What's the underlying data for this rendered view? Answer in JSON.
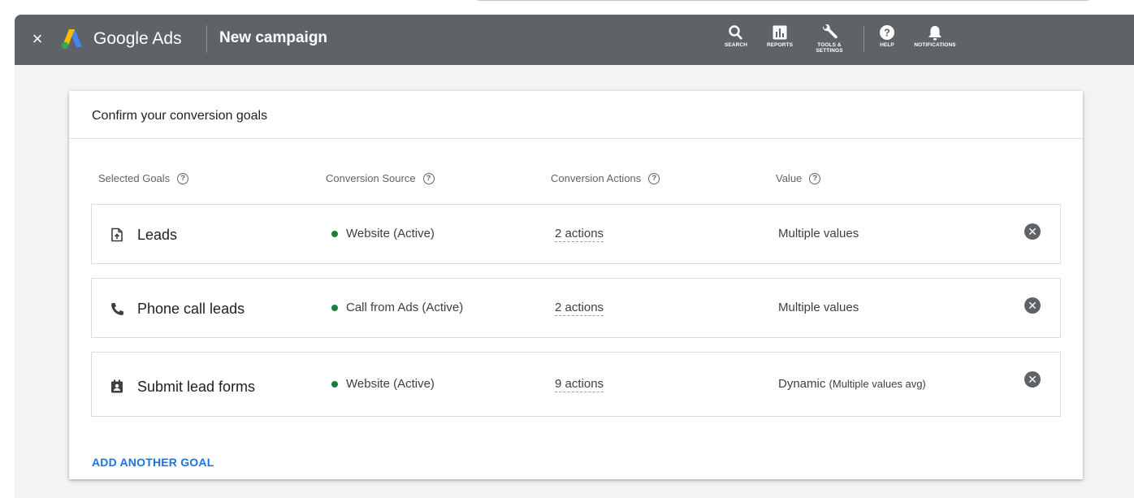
{
  "header": {
    "close_glyph": "×",
    "brand": "Google Ads",
    "page_title": "New campaign",
    "tools": [
      {
        "label": "SEARCH",
        "icon": "search-icon"
      },
      {
        "label": "REPORTS",
        "icon": "reports-icon"
      },
      {
        "label": "TOOLS &",
        "label2": "SETTINGS",
        "icon": "wrench-icon"
      },
      {
        "label": "HELP",
        "icon": "help-icon"
      },
      {
        "label": "NOTIFICATIONS",
        "icon": "bell-icon"
      }
    ]
  },
  "card": {
    "title": "Confirm your conversion goals",
    "columns": [
      "Selected Goals",
      "Conversion Source",
      "Conversion Actions",
      "Value"
    ],
    "help_glyph": "?",
    "remove_glyph": "✕",
    "goals": [
      {
        "name": "Leads",
        "icon": "upload-file-icon",
        "source": "Website (Active)",
        "actions": "2 actions",
        "value": "Multiple values",
        "value_sub": ""
      },
      {
        "name": "Phone call leads",
        "icon": "phone-icon",
        "source": "Call from Ads (Active)",
        "actions": "2 actions",
        "value": "Multiple values",
        "value_sub": ""
      },
      {
        "name": "Submit lead forms",
        "icon": "contact-form-icon",
        "source": "Website (Active)",
        "actions": "9 actions",
        "value": "Dynamic",
        "value_sub": "(Multiple values avg)"
      }
    ],
    "add_goal_label": "ADD ANOTHER GOAL"
  },
  "colors": {
    "topbar": "#5f6368",
    "active_dot": "#188038",
    "link": "#1a73e8"
  }
}
